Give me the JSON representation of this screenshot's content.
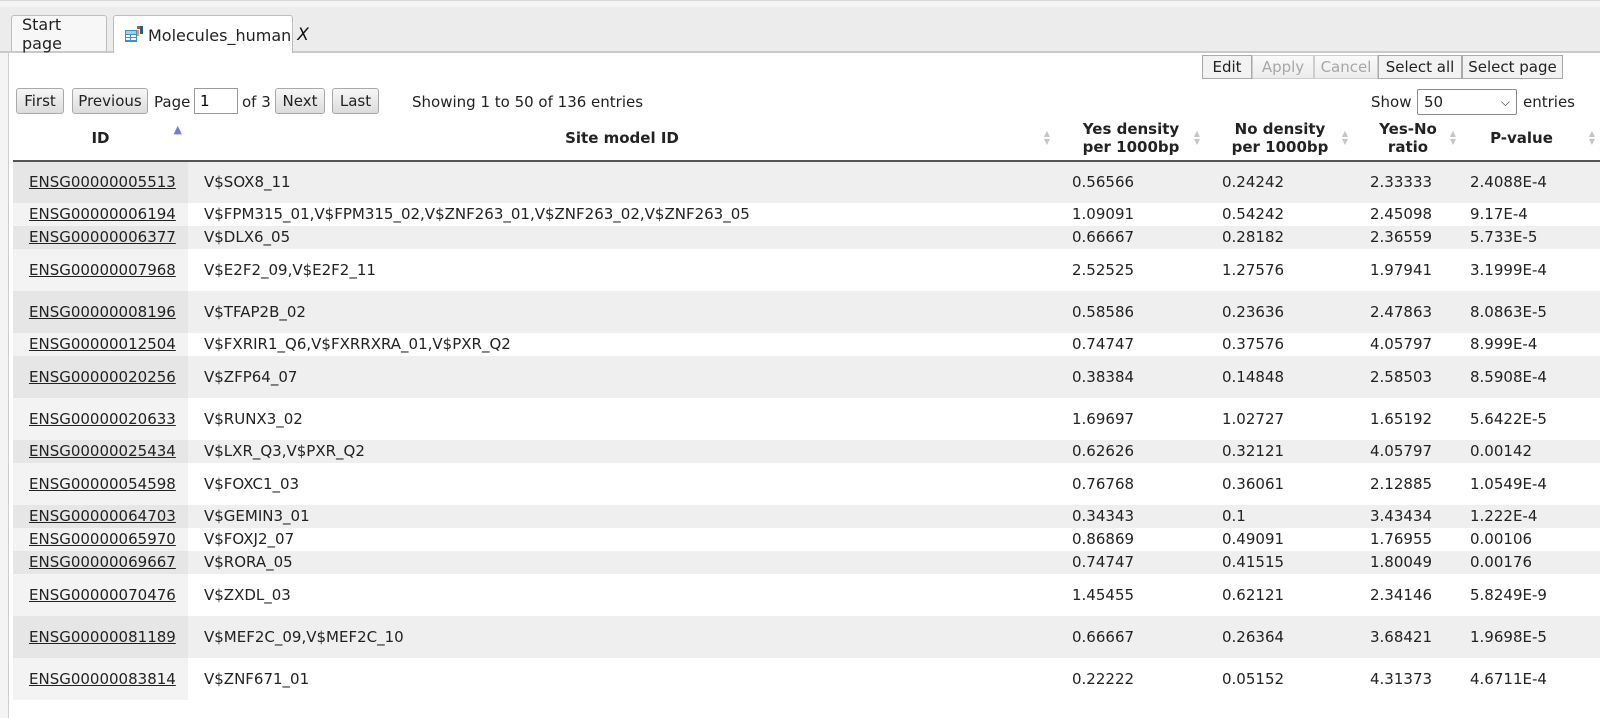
{
  "tabs": [
    {
      "label": "Start page"
    },
    {
      "label": "Molecules_human",
      "close": "X"
    }
  ],
  "toolbar": {
    "edit": "Edit",
    "apply": "Apply",
    "cancel": "Cancel",
    "select_all": "Select all",
    "select_page": "Select page"
  },
  "pager": {
    "first": "First",
    "previous": "Previous",
    "page_label": "Page",
    "page_value": "1",
    "of_label": "of 3",
    "next": "Next",
    "last": "Last",
    "showing": "Showing 1 to 50 of 136 entries",
    "show_label": "Show",
    "show_value": "50",
    "entries_label": "entries"
  },
  "table": {
    "columns": [
      {
        "label": "ID"
      },
      {
        "label": "Site model ID"
      },
      {
        "label": "Yes density per 1000bp"
      },
      {
        "label": "No density per 1000bp"
      },
      {
        "label": "Yes-No ratio"
      },
      {
        "label": "P-value"
      }
    ],
    "rows": [
      {
        "id": "ENSG00000005513",
        "site": "V$SOX8_11",
        "yes": "0.56566",
        "no": "0.24242",
        "ratio": "2.33333",
        "p": "2.4088E-4",
        "tall": true
      },
      {
        "id": "ENSG00000006194",
        "site": "V$FPM315_01,V$FPM315_02,V$ZNF263_01,V$ZNF263_02,V$ZNF263_05",
        "yes": "1.09091",
        "no": "0.54242",
        "ratio": "2.45098",
        "p": "9.17E-4",
        "tall": false
      },
      {
        "id": "ENSG00000006377",
        "site": "V$DLX6_05",
        "yes": "0.66667",
        "no": "0.28182",
        "ratio": "2.36559",
        "p": "5.733E-5",
        "tall": false
      },
      {
        "id": "ENSG00000007968",
        "site": "V$E2F2_09,V$E2F2_11",
        "yes": "2.52525",
        "no": "1.27576",
        "ratio": "1.97941",
        "p": "3.1999E-4",
        "tall": true
      },
      {
        "id": "ENSG00000008196",
        "site": "V$TFAP2B_02",
        "yes": "0.58586",
        "no": "0.23636",
        "ratio": "2.47863",
        "p": "8.0863E-5",
        "tall": true
      },
      {
        "id": "ENSG00000012504",
        "site": "V$FXRIR1_Q6,V$FXRRXRA_01,V$PXR_Q2",
        "yes": "0.74747",
        "no": "0.37576",
        "ratio": "4.05797",
        "p": "8.999E-4",
        "tall": false
      },
      {
        "id": "ENSG00000020256",
        "site": "V$ZFP64_07",
        "yes": "0.38384",
        "no": "0.14848",
        "ratio": "2.58503",
        "p": "8.5908E-4",
        "tall": true
      },
      {
        "id": "ENSG00000020633",
        "site": "V$RUNX3_02",
        "yes": "1.69697",
        "no": "1.02727",
        "ratio": "1.65192",
        "p": "5.6422E-5",
        "tall": true
      },
      {
        "id": "ENSG00000025434",
        "site": "V$LXR_Q3,V$PXR_Q2",
        "yes": "0.62626",
        "no": "0.32121",
        "ratio": "4.05797",
        "p": "0.00142",
        "tall": false
      },
      {
        "id": "ENSG00000054598",
        "site": "V$FOXC1_03",
        "yes": "0.76768",
        "no": "0.36061",
        "ratio": "2.12885",
        "p": "1.0549E-4",
        "tall": true
      },
      {
        "id": "ENSG00000064703",
        "site": "V$GEMIN3_01",
        "yes": "0.34343",
        "no": "0.1",
        "ratio": "3.43434",
        "p": "1.222E-4",
        "tall": false
      },
      {
        "id": "ENSG00000065970",
        "site": "V$FOXJ2_07",
        "yes": "0.86869",
        "no": "0.49091",
        "ratio": "1.76955",
        "p": "0.00106",
        "tall": false
      },
      {
        "id": "ENSG00000069667",
        "site": "V$RORA_05",
        "yes": "0.74747",
        "no": "0.41515",
        "ratio": "1.80049",
        "p": "0.00176",
        "tall": false
      },
      {
        "id": "ENSG00000070476",
        "site": "V$ZXDL_03",
        "yes": "1.45455",
        "no": "0.62121",
        "ratio": "2.34146",
        "p": "5.8249E-9",
        "tall": true
      },
      {
        "id": "ENSG00000081189",
        "site": "V$MEF2C_09,V$MEF2C_10",
        "yes": "0.66667",
        "no": "0.26364",
        "ratio": "3.68421",
        "p": "1.9698E-5",
        "tall": true
      },
      {
        "id": "ENSG00000083814",
        "site": "V$ZNF671_01",
        "yes": "0.22222",
        "no": "0.05152",
        "ratio": "4.31373",
        "p": "4.6711E-4",
        "tall": true
      }
    ]
  }
}
